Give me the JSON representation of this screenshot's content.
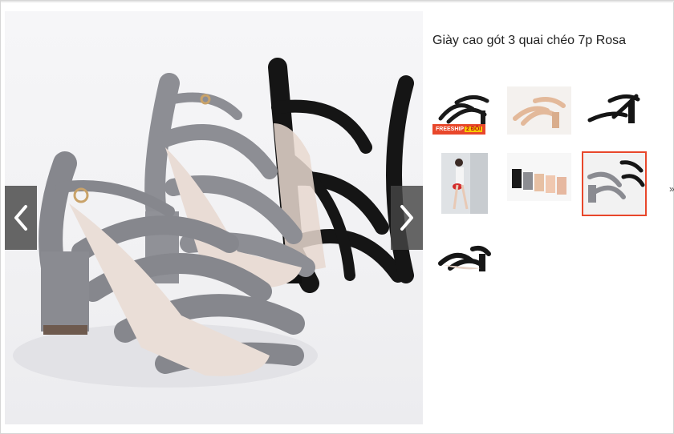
{
  "product": {
    "title": "Giày cao gót 3 quai chéo 7p Rosa"
  },
  "main_image": {
    "alt": "gray and black strappy block-heel sandals"
  },
  "navigation": {
    "prev_icon": "chevron-left-icon",
    "next_icon": "chevron-right-icon"
  },
  "thumbnails": [
    {
      "label": "black sandal front view",
      "active": false,
      "badge": "FREESHIP",
      "badge_highlight": "2 ĐÔI"
    },
    {
      "label": "beige sandal pair",
      "active": false
    },
    {
      "label": "black sandal side view",
      "active": false
    },
    {
      "label": "model wearing sandals",
      "active": false
    },
    {
      "label": "color lineup",
      "active": false
    },
    {
      "label": "gray and black sandals",
      "active": true
    },
    {
      "label": "black sandal pair",
      "active": false
    }
  ],
  "colors": {
    "accent": "#e8472b",
    "badge_highlight": "#f6c900",
    "nav_bg": "#464646"
  }
}
